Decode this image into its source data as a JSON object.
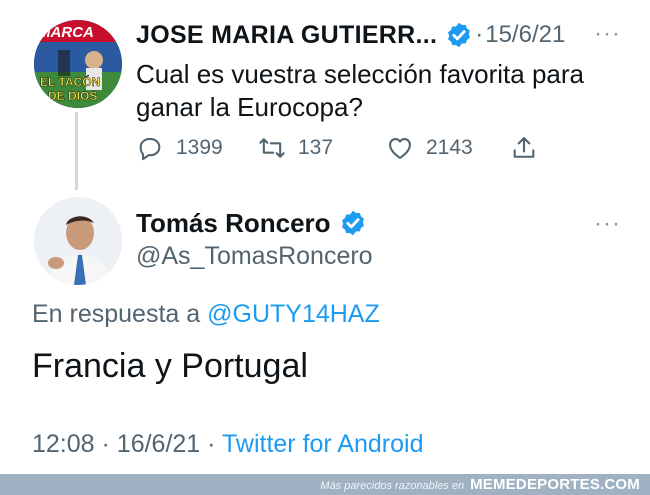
{
  "parent_tweet": {
    "author_name": "JOSE MARIA GUTIERR...",
    "separator": "·",
    "date": "15/6/21",
    "more_label": "···",
    "avatar_lines": [
      "MARCA",
      "EL TACÓN",
      "DE DIOS"
    ],
    "text": "Cual es vuestra selección favorita para ganar la Eurocopa?",
    "actions": {
      "replies": "1399",
      "retweets": "137",
      "likes": "2143"
    }
  },
  "reply_tweet": {
    "author_name": "Tomás Roncero",
    "handle": "@As_TomasRoncero",
    "more_label": "···",
    "in_reply_to_prefix": "En respuesta a",
    "in_reply_to_mention": "@GUTY14HAZ",
    "text": "Francia y Portugal",
    "time": "12:08",
    "separator": "·",
    "date": "16/6/21",
    "separator2": "·",
    "source": "Twitter for Android"
  },
  "watermark": {
    "tagline": "Más parecidos razonables en",
    "brand": "MEMEDEPORTES.COM"
  },
  "colors": {
    "verified": "#1d9bf0",
    "link": "#1d9bf0",
    "secondary_text": "#536471",
    "footer_bg": "#9fb1c2"
  }
}
